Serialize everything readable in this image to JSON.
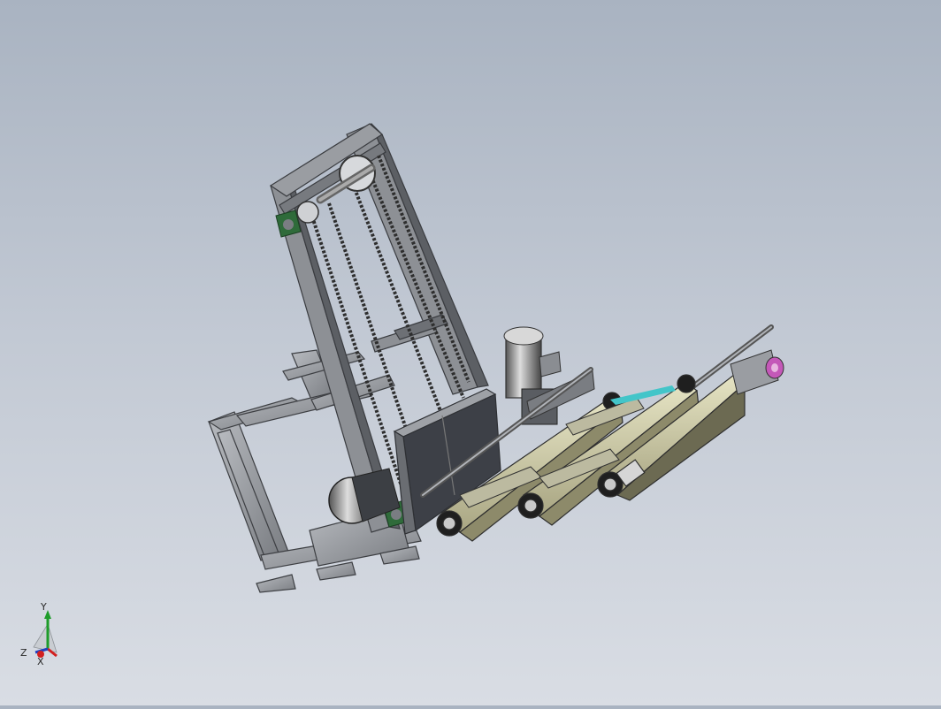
{
  "viewport": {
    "background_top": "#a9b3c1",
    "background_bottom": "#d9dde4",
    "model_colors": {
      "frame": "#8a8d92",
      "frame_dark": "#4f5257",
      "conveyor": "#d9d7b0",
      "chain": "#3a3a3a",
      "bearing": "#2f6b3a",
      "accent_cyan": "#43c5c9",
      "accent_magenta": "#c458b8"
    }
  },
  "triad": {
    "x_label": "X",
    "y_label": "Y",
    "z_label": "Z",
    "x_color": "#d22020",
    "y_color": "#1e9c2a",
    "z_color": "#2040c0"
  }
}
